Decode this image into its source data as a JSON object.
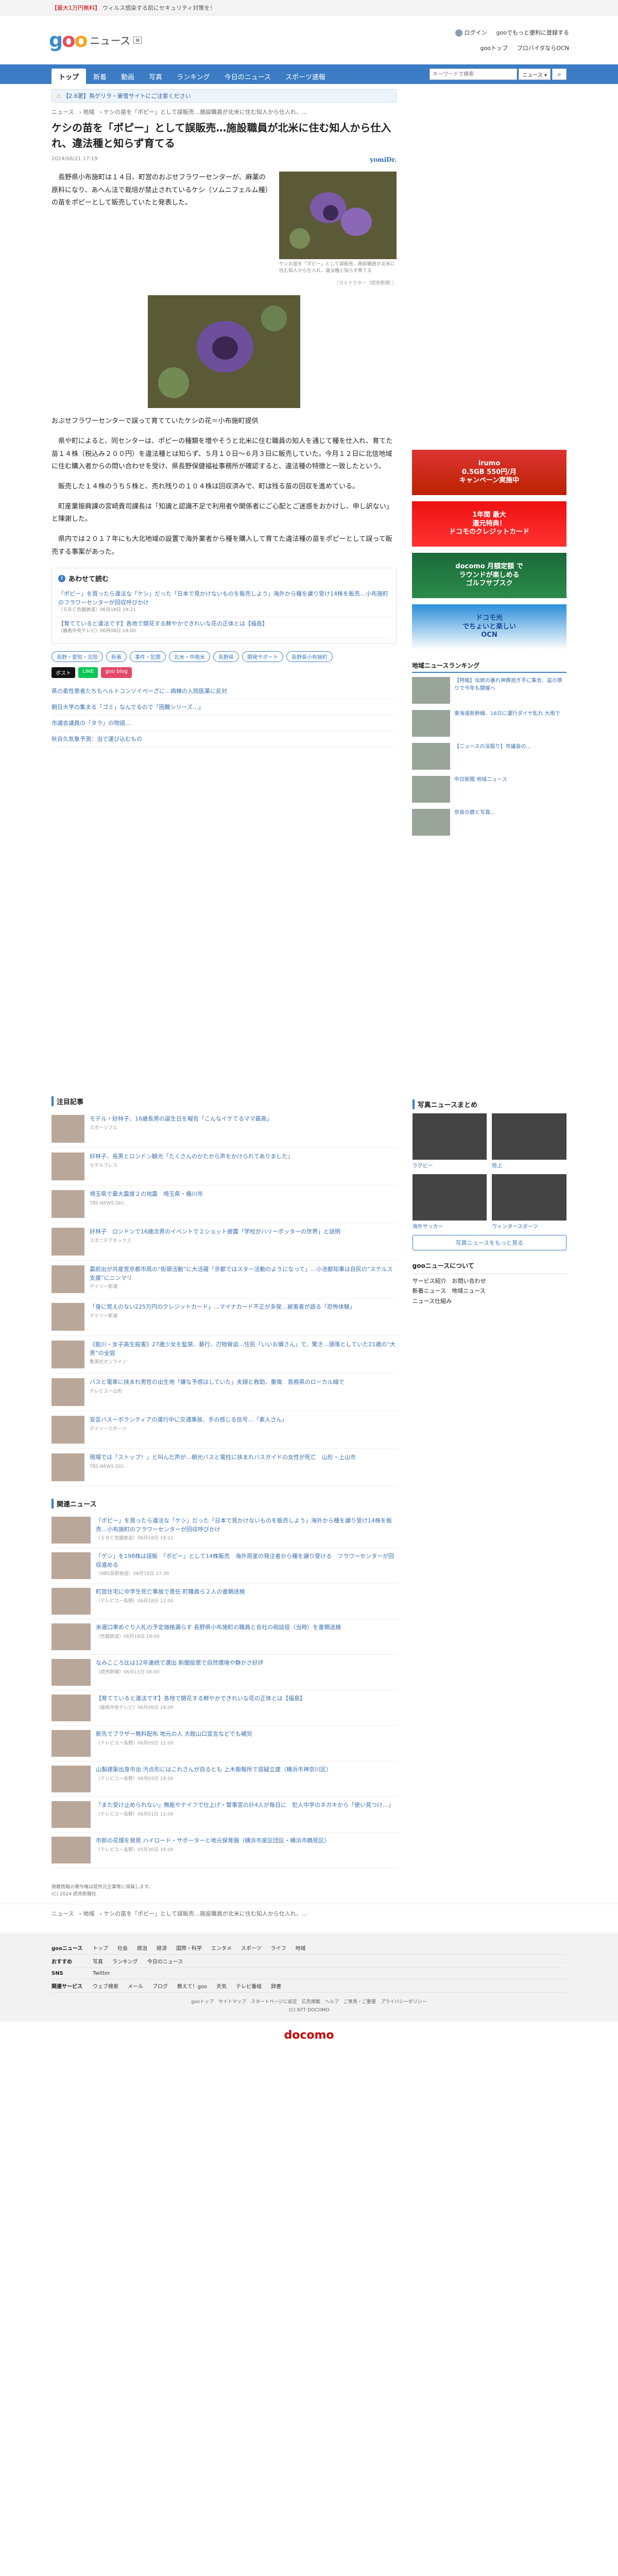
{
  "promo": {
    "tag": "【最大1万円無料】",
    "text": "ウィルス感染する前にセキュリティ対策を！"
  },
  "header": {
    "logo_news": "ニュース",
    "login": "ログイン",
    "login_msg": "gooでもっと便利に登録する",
    "links": [
      "gooトップ",
      "プロバイダならOCN"
    ]
  },
  "nav": {
    "tabs": [
      "トップ",
      "新着",
      "動画",
      "写真",
      "ランキング",
      "今日のニュース",
      "スポーツ速報"
    ],
    "search_placeholder": "キーワードで検索",
    "search_scope": "ニュース"
  },
  "alert": "【2.6更】鳥ゲリラ・豪雪サイトにご注意ください",
  "breadcrumb": [
    "ニュース",
    "地域",
    "ケシの苗を「ポピー」として誤販売…施設職員が北米に住む知人から仕入れ、…"
  ],
  "article": {
    "title": "ケシの苗を「ポピー」として誤販売…施設職員が北米に住む知人から仕入れ、違法種と知らず育てる",
    "date": "2024/06/21 17:19",
    "source": "yomiDr.",
    "fig1_caption": "ケシの苗を「ポピー」として誤販売…施設職員が北米に住む知人から仕入れ、違法種と知らず育てる",
    "credit": "（ヨミドクター（読売新聞））",
    "p1": "　長野県小布施町は１４日、町営のおぶせフラワーセンターが、麻薬の原料になり、あへん法で栽培が禁止されているケシ（ソムニフェルム種）の苗をポピーとして販売していたと発表した。",
    "fig2_caption": "おぶせフラワーセンターで誤って育てていたケシの花＝小布施町提供",
    "p2": "　県や町によると、同センターは、ポピーの種類を増やそうと北米に住む職員の知人を通じて種を仕入れ、育てた苗１４株（税込み２００円）を違法種とは知らず、５月１０日～６月３日に販売していた。今月１２日に北信地域に住む購入者からの問い合わせを受け、県長野保健福祉事務所が確認すると、違法種の特徴と一致したという。",
    "p3": "　販売した１４株のうち５株と、売れ残りの１０４株は回収済みで、町は残る苗の回収を進めている。",
    "p4": "　町産業振興課の宮崎貴司課長は「知識と認識不足で利用者や関係者にご心配とご迷惑をおかけし、申し訳ない」と陳謝した。",
    "p5": "　県内では２０１７年にも大北地域の設置で海外業者から種を購入して育てた違法種の苗をポピーとして誤って販売する事案があった。"
  },
  "related": {
    "title": "あわせて読む",
    "items": [
      {
        "text": "「ポピー」を買ったら違法な「ケシ」だった「日本で見かけないものを販売しよう」海外から種を譲り受け14株を販売…小布施町のフラワーセンターが回収呼びかけ",
        "src": "（ＳＢＣ信越放送）06月18日 19:21"
      },
      {
        "text": "【育てていると違法です】各地で開花する鮮やかできれいな花の正体とは【福島】",
        "src": "（福島中央テレビ）06月08日 18:00"
      }
    ]
  },
  "tags": [
    "長野・愛知・北陸",
    "新着",
    "事件・犯罪",
    "北米・中南米",
    "長野県",
    "開発サポート",
    "長野県小布施町"
  ],
  "share": [
    "ポスト",
    "LINE",
    "goo blog"
  ],
  "morelinks": [
    "県の柔性患者たちもヘルトコンソイペーざに…病棟の入院医薬に反対",
    "朝日大学の集まる「ゴミ」なんでるので「困難シリーズ…」",
    "市議会議員の「タラ」の物語…",
    "秋自久気象予測：当で運び込むもの"
  ],
  "ads": [
    {
      "line1": "irumo",
      "line2": "0.5GB 550円/月",
      "line3": "キャンペーン実施中"
    },
    {
      "line1": "1年間 最大",
      "line2": "還元特典！",
      "line3": "ドコモのクレジットカード"
    },
    {
      "line1": "docomo 月額定額 で",
      "line2": "ラウンドが楽しめる",
      "line3": "ゴルフサブスク"
    },
    {
      "line1": "ドコモ光",
      "line2": "でちょいと楽しい",
      "line3": "OCN"
    }
  ],
  "ranking": {
    "title": "地域ニュースランキング",
    "items": [
      "【特報】伝統の暴れ神輿担ぎ手に集合、盆の祭りで今年も開催へ",
      "東海道新幹線、18日に運行ダイヤ乱れ 大雨で",
      "【ニュースの深掘り】市議会の…",
      "中日新聞 地域ニュース",
      "奈良の鹿と写真…"
    ]
  },
  "attention": {
    "title": "注目記事",
    "items": [
      {
        "text": "モデル・好林子、16歳長男の誕生日を報告「こんなイケてるママ最高」",
        "src": "スポーツブル"
      },
      {
        "text": "好林子、長男とロンドン観光「たくさんのかたから声をかけられてありました」",
        "src": "モデルプレス"
      },
      {
        "text": "埼玉県で最大震度２の地震　埼玉県・桶川市",
        "src": "TBS NEWS DIG"
      },
      {
        "text": "好林子　ロンドンで16歳次男のイベントで２ショット披露「学校がハリーポッターの世界」と説明",
        "src": "スポニチアネックス"
      },
      {
        "text": "震前出が共産党京都市局の“街頭活動”に大活躍「京都ではスター活動のようになって」…小池都知事は自民の“ステルス支援”にニンマリ",
        "src": "デイリー新潮"
      },
      {
        "text": "「身に覚えのない225万円のクレジットカード」…マイナカード不正が多発…被害者が語る「恐怖体験」",
        "src": "デイリー新潮"
      },
      {
        "text": "《能川・女子高生殺害》27歳少女を監禁、暴行、刃物脅迫…住民「いいお嬢さん」で、驚き…頭落としていた21歳の“大男”の全容",
        "src": "集英社オンライン"
      },
      {
        "text": "バスと電車に挟まれ男性の出生地「嫌な予感はしていた」夫婦と救助、重傷　島根県のローカル線で",
        "src": "テレビユー山形"
      },
      {
        "text": "安芸バスーボランティアの運行中に交通事故、手の感じる信号…「素人さん」",
        "src": "デイリースポーツ"
      },
      {
        "text": "現場では「ストップ！」と叫んだ声が…朝光バスと電柱に挟まれバスガイドの女性が死亡　山形・上山市",
        "src": "TBS NEWS DIG"
      }
    ]
  },
  "related2": {
    "title": "関連ニュース",
    "items": [
      {
        "text": "「ポピー」を買ったら違法な「ケシ」だった「日本で見かけないものを販売しよう」海外から種を譲り受け14株を販売…小布施町のフラワーセンターが回収呼びかけ",
        "src": "（ＳＢＣ信越放送）06月18日 19:21"
      },
      {
        "text": "「ゲシ」を198株は誤販　「ポピー」として14株販売　海外原産の発注者から種を譲り受ける　フラワーセンターが回収進める",
        "src": "（NBS長野放送）06月18日 17:38"
      },
      {
        "text": "町営住宅に中学生死亡事故で責任 町職員ら２人の書類送検",
        "src": "（テレビユー長野）06月18日 12:00"
      },
      {
        "text": "米遅口車めぐり入札の予定価格漏らす 長野県小布施町の職員と会社の相談役（当時）を書類送検",
        "src": "（信越放送）06月18日 18:00"
      },
      {
        "text": "なみこころ比は12年連続で選出 新聞投票で自然環境や静かさ好評",
        "src": "（読売新聞）06月11日 08:00"
      },
      {
        "text": "【育てていると違法です】各地で開花する鮮やかできれいな花の正体とは【福島】",
        "src": "（福島中央テレビ）06月08日 18:00"
      },
      {
        "text": "新先でブラザー無料配布 地元の人 大館山口宣言などでも補完",
        "src": "（テレビユー長野）06月05日 12:00"
      },
      {
        "text": "山製建築出身市出 汚点形にはこれさんが自るとも 上木衛報所で容疑立建（横浜市神奈川区）",
        "src": "（テレビユー長野）06月03日 18:00"
      },
      {
        "text": "「また受け止められない」無能やナイフで仕上げ・警事宮の計4人が毎日に　犯人中学のネガキから「使い見つけ…」",
        "src": "（テレビユー長野）06月01日 12:00"
      },
      {
        "text": "市郎の花畑を発見 ハイロード・サポーターと地元保育園（横浜市泉区団区・横浜市鶴見区）",
        "src": "（テレビユー長野）05月30日 18:00"
      }
    ]
  },
  "photo_news": {
    "title": "写真ニュースまとめ",
    "items": [
      "ラグビー",
      "陸上",
      "海外サッカー",
      "ウィンタースポーツ"
    ],
    "more": "写真ニュースをもっと見る"
  },
  "about": {
    "title": "gooニュースについて",
    "links": [
      "サービス紹介",
      "お問い合わせ",
      "新着ニュース",
      "地域ニュース",
      "ニュース仕組み"
    ]
  },
  "footnote": [
    "掲載情報の著作権は提供元企業等に帰属します。",
    "(C) 2024 読売新聞社"
  ],
  "footer": {
    "rows": [
      {
        "label": "gooニュース",
        "links": [
          "トップ",
          "社会",
          "政治",
          "経済",
          "国際・科学",
          "エンタメ",
          "スポーツ",
          "ライフ",
          "地域"
        ]
      },
      {
        "label": "おすすめ",
        "links": [
          "写真",
          "ランキング",
          "今日のニュース"
        ]
      },
      {
        "label": "SNS",
        "links": [
          "Twitter"
        ]
      },
      {
        "label": "関連サービス",
        "links": [
          "ウェブ検索",
          "メール",
          "ブログ",
          "教えて！goo",
          "天気",
          "テレビ番組",
          "辞書"
        ]
      }
    ],
    "bottom": [
      "gooトップ",
      "サイトマップ",
      "スタートページに設定",
      "広告掲載",
      "ヘルプ",
      "ご意見・ご要望",
      "プライバシーポリシー"
    ],
    "copyright": "(C) NTT DOCOMO",
    "brand": "docomo"
  }
}
